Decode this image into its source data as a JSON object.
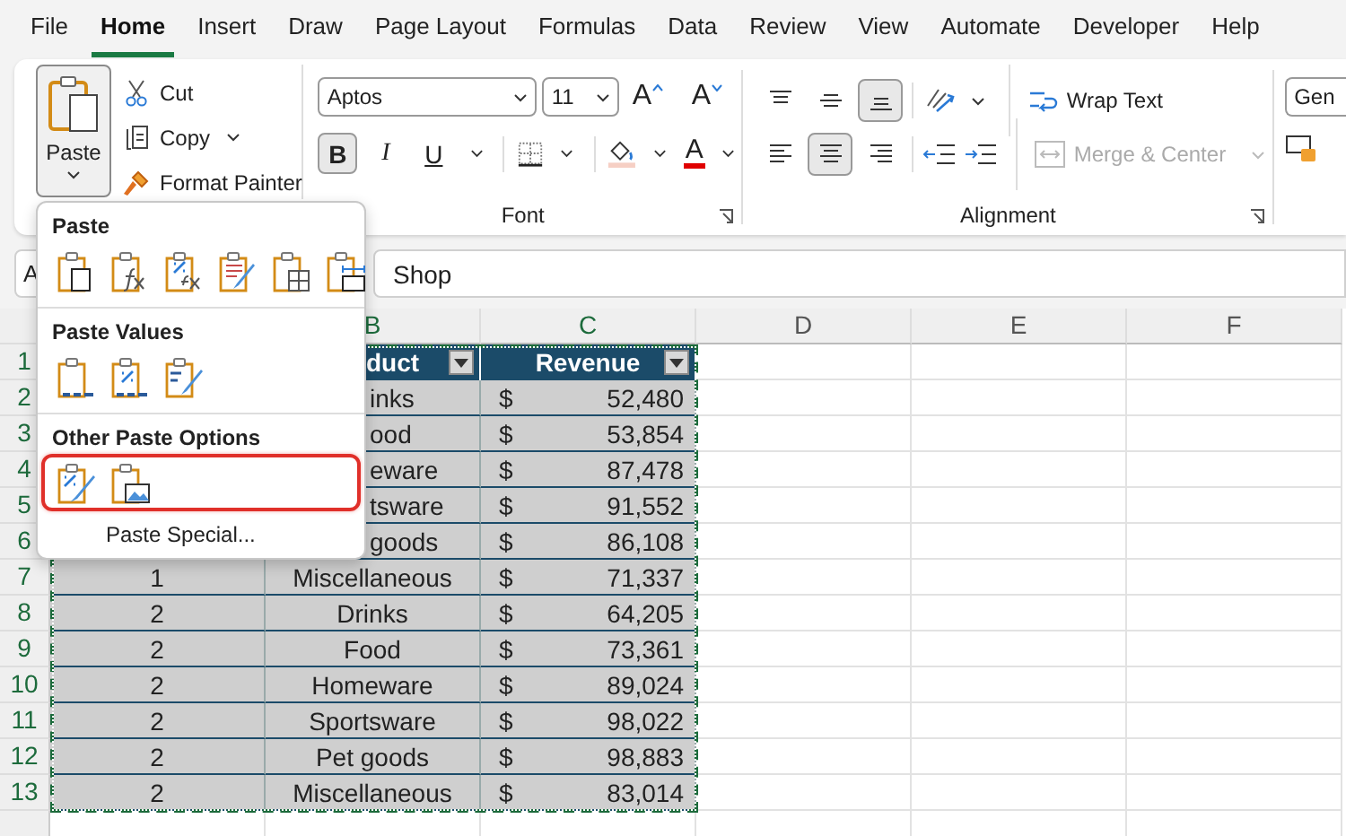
{
  "tabs": [
    {
      "label": "File",
      "selected": false
    },
    {
      "label": "Home",
      "selected": true
    },
    {
      "label": "Insert",
      "selected": false
    },
    {
      "label": "Draw",
      "selected": false
    },
    {
      "label": "Page Layout",
      "selected": false
    },
    {
      "label": "Formulas",
      "selected": false
    },
    {
      "label": "Data",
      "selected": false
    },
    {
      "label": "Review",
      "selected": false
    },
    {
      "label": "View",
      "selected": false
    },
    {
      "label": "Automate",
      "selected": false
    },
    {
      "label": "Developer",
      "selected": false
    },
    {
      "label": "Help",
      "selected": false
    }
  ],
  "clipboard": {
    "paste": {
      "label": "Paste",
      "pressed": true
    },
    "commands": [
      {
        "kind": "cut",
        "label": "Cut",
        "dropdown": false
      },
      {
        "kind": "copy",
        "label": "Copy",
        "dropdown": true
      },
      {
        "kind": "painter",
        "label": "Format Painter",
        "dropdown": false
      }
    ]
  },
  "font": {
    "name": "Aptos",
    "size": "11",
    "grow": "A",
    "shrink": "A",
    "toggles": [
      {
        "kind": "bold",
        "label": "B",
        "on": true
      },
      {
        "kind": "italic",
        "label": "I",
        "on": false
      },
      {
        "kind": "underline",
        "label": "U",
        "on": false
      }
    ],
    "color_label": "A",
    "label": "Font"
  },
  "alignment": {
    "vertical": [
      {
        "kind": "top",
        "on": false
      },
      {
        "kind": "middle",
        "on": false
      },
      {
        "kind": "bottom",
        "on": true
      }
    ],
    "horizontal": [
      {
        "kind": "left",
        "on": false
      },
      {
        "kind": "center",
        "on": true
      },
      {
        "kind": "right",
        "on": false
      }
    ],
    "wrap_text": "Wrap Text",
    "merge": {
      "label": "Merge & Center",
      "disabled": true
    },
    "label": "Alignment"
  },
  "number": {
    "format": "Gen"
  },
  "formula_bar": {
    "name_box": "A",
    "formula": "Shop"
  },
  "paste_menu": {
    "sections": [
      {
        "title": "Paste",
        "highlighted": false,
        "options": [
          {
            "kind": "paste"
          },
          {
            "kind": "formulas"
          },
          {
            "kind": "formulas-number"
          },
          {
            "kind": "source-format"
          },
          {
            "kind": "no-borders"
          },
          {
            "kind": "column-widths"
          }
        ]
      },
      {
        "title": "Paste Values",
        "highlighted": false,
        "options": [
          {
            "kind": "values"
          },
          {
            "kind": "values-number"
          },
          {
            "kind": "values-source"
          }
        ]
      },
      {
        "title": "Other Paste Options",
        "highlighted": true,
        "options": [
          {
            "kind": "formatting"
          },
          {
            "kind": "picture"
          }
        ]
      }
    ],
    "special": "Paste Special..."
  },
  "sheet": {
    "columns": [
      {
        "label": "B",
        "selected": true
      },
      {
        "label": "C",
        "selected": true
      },
      {
        "label": "D",
        "selected": false
      },
      {
        "label": "E",
        "selected": false
      },
      {
        "label": "F",
        "selected": false
      }
    ],
    "rows": [
      {
        "number": "1",
        "selected": true,
        "kind": "header",
        "b": "duct",
        "c": "Revenue"
      },
      {
        "number": "2",
        "selected": true,
        "kind": "data",
        "b": "inks",
        "currency": "$",
        "c": "52,480"
      },
      {
        "number": "3",
        "selected": true,
        "kind": "data",
        "b": "ood",
        "currency": "$",
        "c": "53,854"
      },
      {
        "number": "4",
        "selected": true,
        "kind": "data",
        "b": "eware",
        "currency": "$",
        "c": "87,478"
      },
      {
        "number": "5",
        "selected": true,
        "kind": "data",
        "b": "tsware",
        "currency": "$",
        "c": "91,552"
      },
      {
        "number": "6",
        "selected": true,
        "kind": "data",
        "b": "goods",
        "currency": "$",
        "c": "86,108"
      },
      {
        "number": "7",
        "selected": true,
        "kind": "data",
        "a": "1",
        "b": "Miscellaneous",
        "currency": "$",
        "c": "71,337"
      },
      {
        "number": "8",
        "selected": true,
        "kind": "data",
        "a": "2",
        "b": "Drinks",
        "currency": "$",
        "c": "64,205"
      },
      {
        "number": "9",
        "selected": true,
        "kind": "data",
        "a": "2",
        "b": "Food",
        "currency": "$",
        "c": "73,361"
      },
      {
        "number": "10",
        "selected": true,
        "kind": "data",
        "a": "2",
        "b": "Homeware",
        "currency": "$",
        "c": "89,024"
      },
      {
        "number": "11",
        "selected": true,
        "kind": "data",
        "a": "2",
        "b": "Sportsware",
        "currency": "$",
        "c": "98,022"
      },
      {
        "number": "12",
        "selected": true,
        "kind": "data",
        "a": "2",
        "b": "Pet goods",
        "currency": "$",
        "c": "98,883"
      },
      {
        "number": "13",
        "selected": true,
        "kind": "data",
        "a": "2",
        "b": "Miscellaneous",
        "currency": "$",
        "c": "83,014"
      }
    ]
  }
}
